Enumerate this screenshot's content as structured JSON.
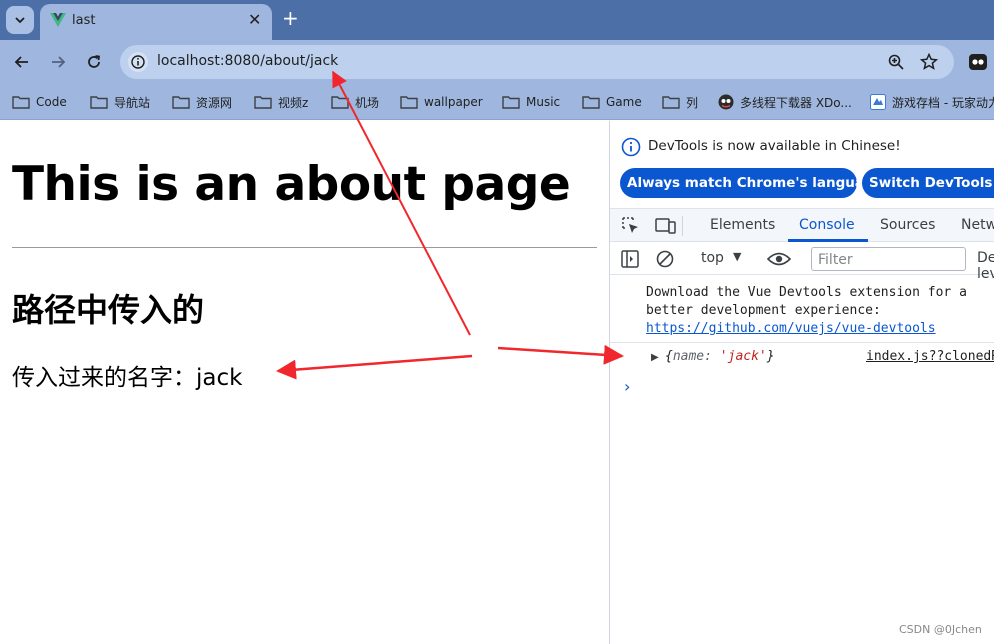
{
  "browser": {
    "tab_title": "last",
    "url": "localhost:8080/about/jack",
    "bookmarks": [
      "Code",
      "导航站",
      "资源网",
      "视频z",
      "机场",
      "wallpaper",
      "Music",
      "Game",
      "列",
      "多线程下载器 XDo...",
      "游戏存档 - 玩家动力"
    ]
  },
  "page": {
    "heading": "This is an about page",
    "subheading": "路径中传入的",
    "name_line": "传入过来的名字：jack"
  },
  "devtools": {
    "banner": "DevTools is now available in Chinese!",
    "btn_match": "Always match Chrome's language",
    "btn_switch": "Switch DevTools to Chinese",
    "tabs": [
      "Elements",
      "Console",
      "Sources",
      "Network"
    ],
    "context": "top",
    "filter_placeholder": "Filter",
    "levels": "Default levels",
    "console_msg1_line1": "Download the Vue Devtools extension for a",
    "console_msg1_line2": "better development experience:",
    "console_msg1_link": "https://github.com/vuejs/vue-devtools",
    "console_msg2_key": "name",
    "console_msg2_value": "'jack'",
    "console_msg2_source": "index.js??clonedRuleSet",
    "prompt": "›"
  },
  "watermark": "CSDN @0Jchen",
  "colors": {
    "annotation": "#f0282d",
    "accent": "#0b57d0",
    "frame": "#4d6fa7"
  }
}
